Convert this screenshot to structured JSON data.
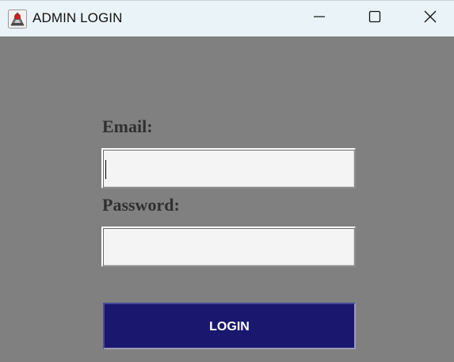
{
  "window": {
    "title": "ADMIN LOGIN",
    "icon": "java-coffee-cup-icon",
    "controls": {
      "minimize_icon": "minimize-icon",
      "maximize_icon": "maximize-icon",
      "close_icon": "close-icon"
    }
  },
  "form": {
    "email_label": "Email:",
    "email_value": "",
    "password_label": "Password:",
    "password_value": "",
    "login_label": "LOGIN"
  },
  "colors": {
    "background": "#808080",
    "titlebar": "#eaf4f8",
    "field_background": "#f4f4f4",
    "label_text": "#303030",
    "button_background": "#19186e",
    "button_text": "#ffffff"
  }
}
